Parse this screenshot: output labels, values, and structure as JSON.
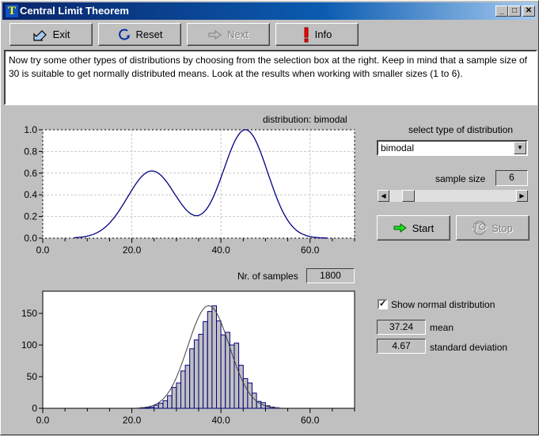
{
  "window": {
    "title": "Central Limit Theorem",
    "app_icon": "T",
    "controls": {
      "minimize": "_",
      "maximize": "□",
      "close": "✕"
    }
  },
  "toolbar": {
    "exit_label": "Exit",
    "reset_label": "Reset",
    "next_label": "Next",
    "info_label": "Info",
    "next_disabled": true
  },
  "instructions": "Now try some other types of distributions by choosing from the selection box at the right. Keep in mind that a sample size of 30 is suitable to get normally distributed means. Look at the results when working with smaller sizes (1 to 6).",
  "controls": {
    "select_label": "select type of distribution",
    "distribution_selected": "bimodal",
    "sample_size_label": "sample size",
    "sample_size_value": "6",
    "slider_fraction": 0.17,
    "start_label": "Start",
    "stop_label": "Stop",
    "stop_disabled": true,
    "show_normal_label": "Show normal distribution",
    "show_normal_checked": true,
    "mean_value": "37.24",
    "mean_label": "mean",
    "sd_value": "4.67",
    "sd_label": "standard deviation"
  },
  "samples": {
    "label": "Nr. of samples",
    "value": "1800"
  },
  "chart_data": [
    {
      "type": "line",
      "title": "distribution: bimodal",
      "xlabel": "",
      "ylabel": "",
      "xlim": [
        0,
        70
      ],
      "ylim": [
        0,
        1.0
      ],
      "x_ticks": [
        "0.0",
        "20.0",
        "40.0",
        "60.0"
      ],
      "x_tick_values": [
        0,
        20,
        40,
        60
      ],
      "x_minor_step": 5,
      "y_ticks": [
        "0.0",
        "0.2",
        "0.4",
        "0.6",
        "0.8",
        "1.0"
      ],
      "y_tick_values": [
        0,
        0.2,
        0.4,
        0.6,
        0.8,
        1.0
      ],
      "grid": true,
      "series": [
        {
          "name": "bimodal density",
          "components": [
            {
              "mu": 24.5,
              "sigma": 5.5,
              "amp": 0.62
            },
            {
              "mu": 45.5,
              "sigma": 5.0,
              "amp": 1.0
            }
          ],
          "x_range": [
            7,
            64
          ],
          "color": "#000080"
        }
      ]
    },
    {
      "type": "bar",
      "title": "",
      "xlabel": "",
      "ylabel": "",
      "xlim": [
        0,
        70
      ],
      "ylim": [
        0,
        185
      ],
      "x_ticks": [
        "0.0",
        "20.0",
        "40.0",
        "60.0"
      ],
      "x_tick_values": [
        0,
        20,
        40,
        60
      ],
      "x_minor_step": 5,
      "y_ticks": [
        "0",
        "50",
        "100",
        "150"
      ],
      "y_tick_values": [
        0,
        50,
        100,
        150
      ],
      "grid": false,
      "bin_width": 1,
      "bins_start": [
        22,
        23,
        24,
        25,
        26,
        27,
        28,
        29,
        30,
        31,
        32,
        33,
        34,
        35,
        36,
        37,
        38,
        39,
        40,
        41,
        42,
        43,
        44,
        45,
        46,
        47,
        48,
        49,
        50,
        51,
        52
      ],
      "values": [
        1,
        1,
        2,
        5,
        8,
        12,
        20,
        33,
        40,
        59,
        68,
        94,
        108,
        117,
        137,
        153,
        162,
        138,
        116,
        120,
        100,
        103,
        68,
        47,
        40,
        24,
        11,
        9,
        4,
        2,
        1
      ],
      "bar_color": "#c0c0c0",
      "bar_edge": "#000080",
      "normal_overlay": {
        "mean": 37.24,
        "sd": 4.67,
        "peak": 162,
        "color": "#404040"
      }
    }
  ]
}
